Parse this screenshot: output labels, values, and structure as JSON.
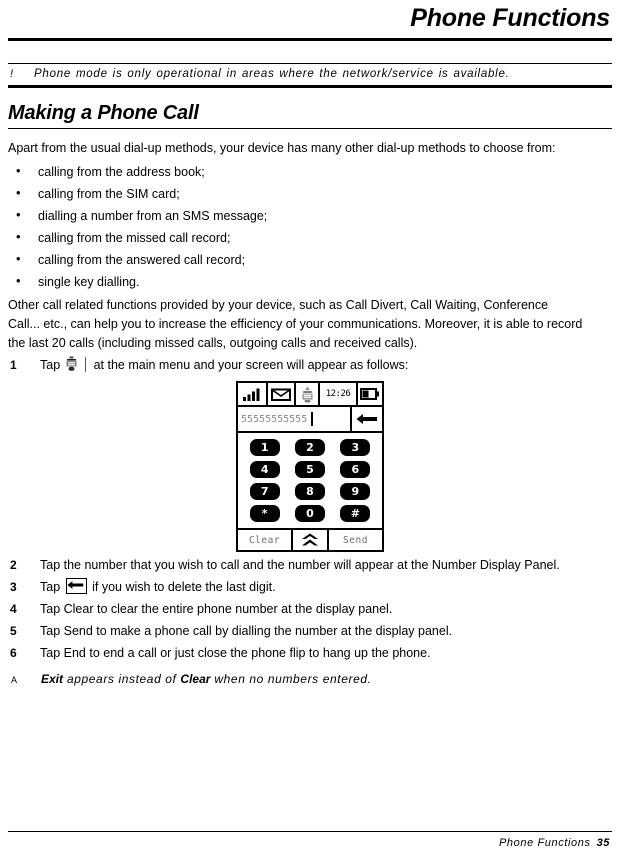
{
  "header": {
    "doc_title": "Phone Functions"
  },
  "note": {
    "mark": "!",
    "text": "Phone mode is only operational in areas where the network/service is available."
  },
  "section": {
    "heading": "Making a Phone Call",
    "intro": "Apart from the usual dial-up methods, your device has many other dial-up methods to choose from:",
    "bullets": [
      "calling from the address book;",
      "calling from the SIM card;",
      "dialling a number from an SMS message;",
      "calling from the missed call record;",
      "calling from the answered call record;",
      "single key dialling."
    ],
    "outro": "Other call related functions provided by your device, such as Call Divert, Call Waiting, Conference Call... etc., can help you to increase the efficiency of your communications. Moreover, it is able to record the last 20 calls (including missed calls, outgoing calls and received calls)."
  },
  "steps": [
    {
      "num": "1",
      "pre": "Tap",
      "icon": "phone-app-icon",
      "post": "at the main menu and your screen will appear as follows:"
    },
    {
      "num": "2",
      "text": "Tap the number that you wish to call and the number will appear at the Number Display Panel."
    },
    {
      "num": "3",
      "pre": "Tap",
      "icon": "backspace-icon",
      "post": "if you wish to delete the last digit."
    },
    {
      "num": "4",
      "text": "Tap Clear to clear the entire phone number at the display panel."
    },
    {
      "num": "5",
      "text": "Tap Send to make a phone call by dialling the number at the display panel."
    },
    {
      "num": "6",
      "text": "Tap End to end a call or just close the phone flip to hang up the phone."
    }
  ],
  "phone_mock": {
    "status_bar": {
      "signal_icon": "signal-bars-icon",
      "signal_bars": 4,
      "mail_icon": "envelope-icon",
      "alarm_icon": "alarm-icon",
      "time": "12:26",
      "battery_icon": "battery-icon"
    },
    "number_display": {
      "value": "55555555555",
      "backspace_icon": "backspace-arrow-icon"
    },
    "keypad": [
      [
        "1",
        "2",
        "3"
      ],
      [
        "4",
        "5",
        "6"
      ],
      [
        "7",
        "8",
        "9"
      ],
      [
        "*",
        "0",
        "#"
      ]
    ],
    "softkeys": {
      "left": "Clear",
      "middle_icon": "double-chevron-up-icon",
      "right": "Send"
    }
  },
  "tip": {
    "mark": "A",
    "bold_1": "Exit",
    "mid": " appears instead of ",
    "bold_2": "Clear",
    "tail": " when no numbers entered."
  },
  "footer": {
    "label": "Phone Functions",
    "page": "35"
  }
}
